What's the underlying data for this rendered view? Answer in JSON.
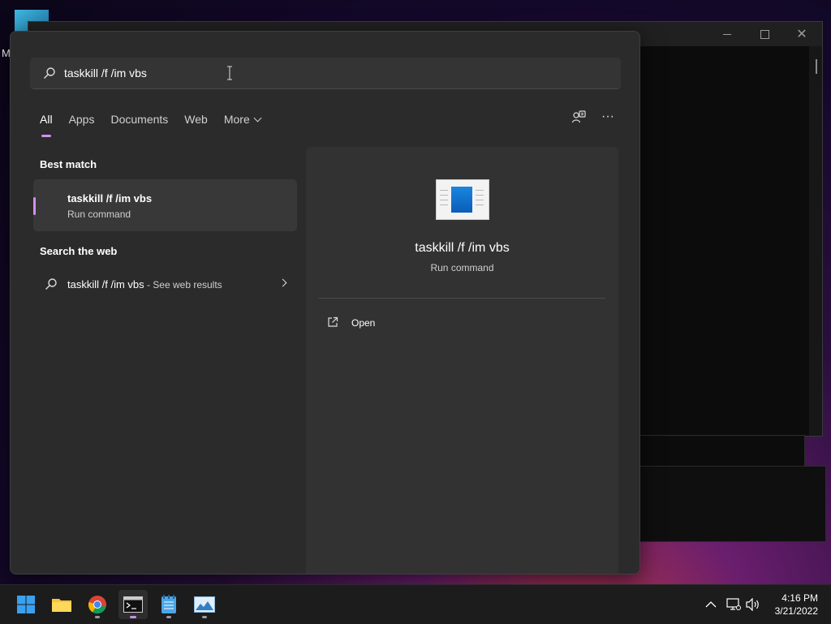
{
  "desktop": {
    "partial_label": "M"
  },
  "background_window": {
    "controls": {
      "minimize": "minimize-icon",
      "maximize": "maximize-icon",
      "close": "close-icon"
    }
  },
  "search": {
    "query": "taskkill /f /im vbs",
    "search_icon": "search-icon"
  },
  "tabs": [
    {
      "label": "All",
      "active": true
    },
    {
      "label": "Apps"
    },
    {
      "label": "Documents"
    },
    {
      "label": "Web"
    },
    {
      "label": "More"
    }
  ],
  "tools": {
    "share_icon": "share-icon",
    "more_icon": "ellipsis-icon",
    "more_label": "···"
  },
  "best_match": {
    "heading": "Best match",
    "title": "taskkill /f /im vbs",
    "subtitle": "Run command"
  },
  "web": {
    "heading": "Search the web",
    "query": "taskkill /f /im vbs",
    "suffix": " - See web results"
  },
  "detail": {
    "title": "taskkill /f /im vbs",
    "subtitle": "Run command",
    "actions": [
      {
        "label": "Open",
        "icon": "open-external-icon"
      }
    ]
  },
  "taskbar": {
    "apps": [
      "start-icon",
      "file-explorer-icon",
      "chrome-icon",
      "terminal-icon",
      "notepad-icon",
      "photos-icon"
    ],
    "tray": [
      "chevron-up-icon",
      "network-icon",
      "volume-icon"
    ],
    "time": "4:16 PM",
    "date": "3/21/2022"
  },
  "colors": {
    "accent": "#d18ff0",
    "panel": "#2b2b2b",
    "taskbar": "#1c1c1c"
  }
}
